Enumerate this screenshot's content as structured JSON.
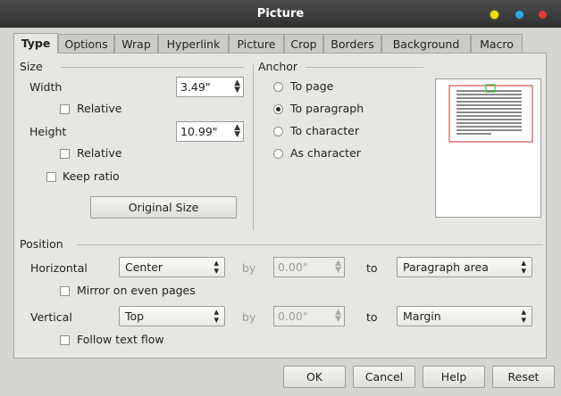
{
  "window": {
    "title": "Picture"
  },
  "tabs": [
    "Type",
    "Options",
    "Wrap",
    "Hyperlink",
    "Picture",
    "Crop",
    "Borders",
    "Background",
    "Macro"
  ],
  "size": {
    "heading": "Size",
    "width_label": "Width",
    "width_value": "3.49\"",
    "width_relative": "Relative",
    "height_label": "Height",
    "height_value": "10.99\"",
    "height_relative": "Relative",
    "keep_ratio": "Keep ratio",
    "original_size": "Original Size"
  },
  "anchor": {
    "heading": "Anchor",
    "options": [
      "To page",
      "To paragraph",
      "To character",
      "As character"
    ],
    "selected": "To paragraph"
  },
  "position": {
    "heading": "Position",
    "horizontal_label": "Horizontal",
    "horizontal_value": "Center",
    "by": "by",
    "horizontal_by": "0.00\"",
    "to": "to",
    "horizontal_to": "Paragraph area",
    "mirror": "Mirror on even pages",
    "vertical_label": "Vertical",
    "vertical_value": "Top",
    "vertical_by": "0.00\"",
    "vertical_to": "Margin",
    "follow": "Follow text flow"
  },
  "buttons": {
    "ok": "OK",
    "cancel": "Cancel",
    "help": "Help",
    "reset": "Reset"
  }
}
